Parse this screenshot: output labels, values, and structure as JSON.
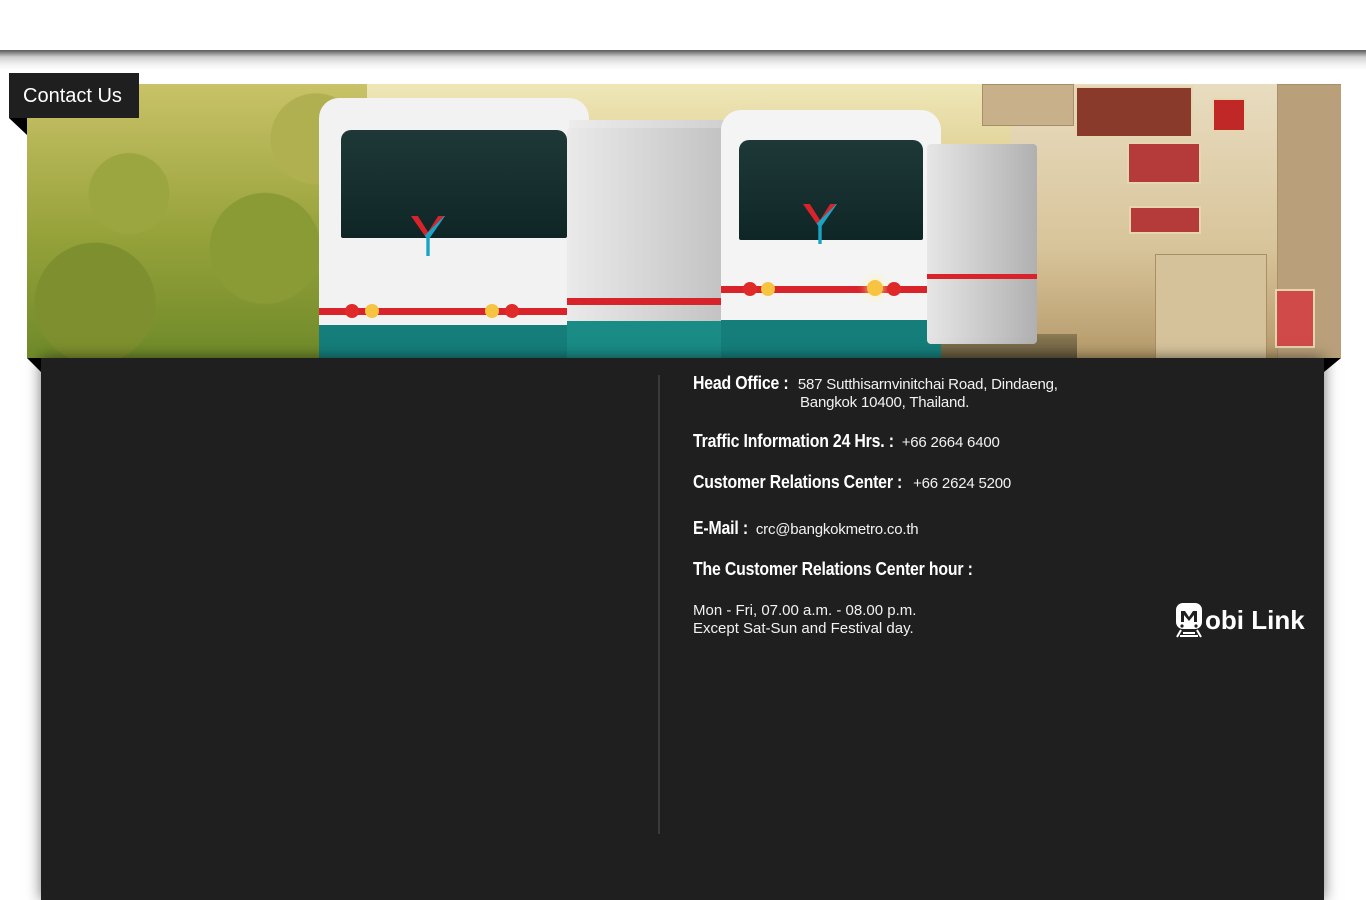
{
  "header": {
    "tab_label": "Contact Us"
  },
  "contact": {
    "head_office": {
      "label": "Head Office :",
      "address_line1": "587 Sutthisarnvinitchai Road, Dindaeng,",
      "address_line2": "Bangkok 10400, Thailand."
    },
    "traffic": {
      "label": "Traffic Information 24 Hrs. :",
      "value": "+66 2664 6400"
    },
    "crc": {
      "label": "Customer Relations Center :",
      "value": "+66 2624 5200"
    },
    "email": {
      "label": "E-Mail :",
      "value": "crc@bangkokmetro.co.th"
    },
    "hours": {
      "label": "The Customer Relations Center hour :",
      "line1": "Mon - Fri, 07.00 a.m. - 08.00 p.m.",
      "line2": "Except Sat-Sun and Festival day."
    }
  },
  "branding": {
    "mobi_link_text": "obi Link",
    "mobi_link_icon": "train-m-icon"
  },
  "colors": {
    "panel": "#1f1f1f",
    "text": "#ffffff",
    "tab": "#1f1f1f"
  }
}
